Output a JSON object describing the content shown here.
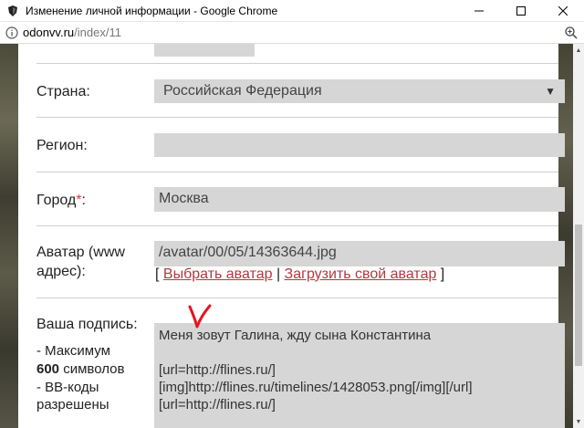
{
  "window": {
    "title": "Изменение личной информации - Google Chrome",
    "minimize_icon": "minimize-icon",
    "maximize_icon": "maximize-icon",
    "close_icon": "close-icon"
  },
  "address": {
    "host": "odonvv.ru",
    "path": "/index/11"
  },
  "form": {
    "country_label": "Страна:",
    "country_value": "Российская Федерация",
    "region_label": "Регион:",
    "region_value": "",
    "city_label": "Город",
    "city_required": "*",
    "city_colon": ":",
    "city_value": "Москва",
    "avatar_label_line1": "Аватар (www",
    "avatar_label_line2": "адрес):",
    "avatar_value": "/avatar/00/05/14363644.jpg",
    "bracket_open": "[ ",
    "choose_avatar": "Выбрать аватар",
    "divider": " | ",
    "upload_avatar": "Загрузить свой аватар",
    "bracket_close": " ]",
    "signature_label": "Ваша подпись:",
    "hint_max_prefix": "- Максимум",
    "hint_max_number": "600",
    "hint_max_suffix": " символов",
    "hint_bb_line1": "- BB-коды",
    "hint_bb_line2": "разрешены",
    "signature_lines": [
      "Меня зовут Галина, жду сына Константина",
      "",
      "[url=http://flines.ru/]",
      "[img]http://flines.ru/timelines/1428053.png[/img][/url]",
      "[url=http://flines.ru/]"
    ]
  },
  "colors": {
    "link": "#b5373f",
    "required": "#d33333",
    "field_bg": "#d6d6d6",
    "annotation": "#e8141e"
  }
}
